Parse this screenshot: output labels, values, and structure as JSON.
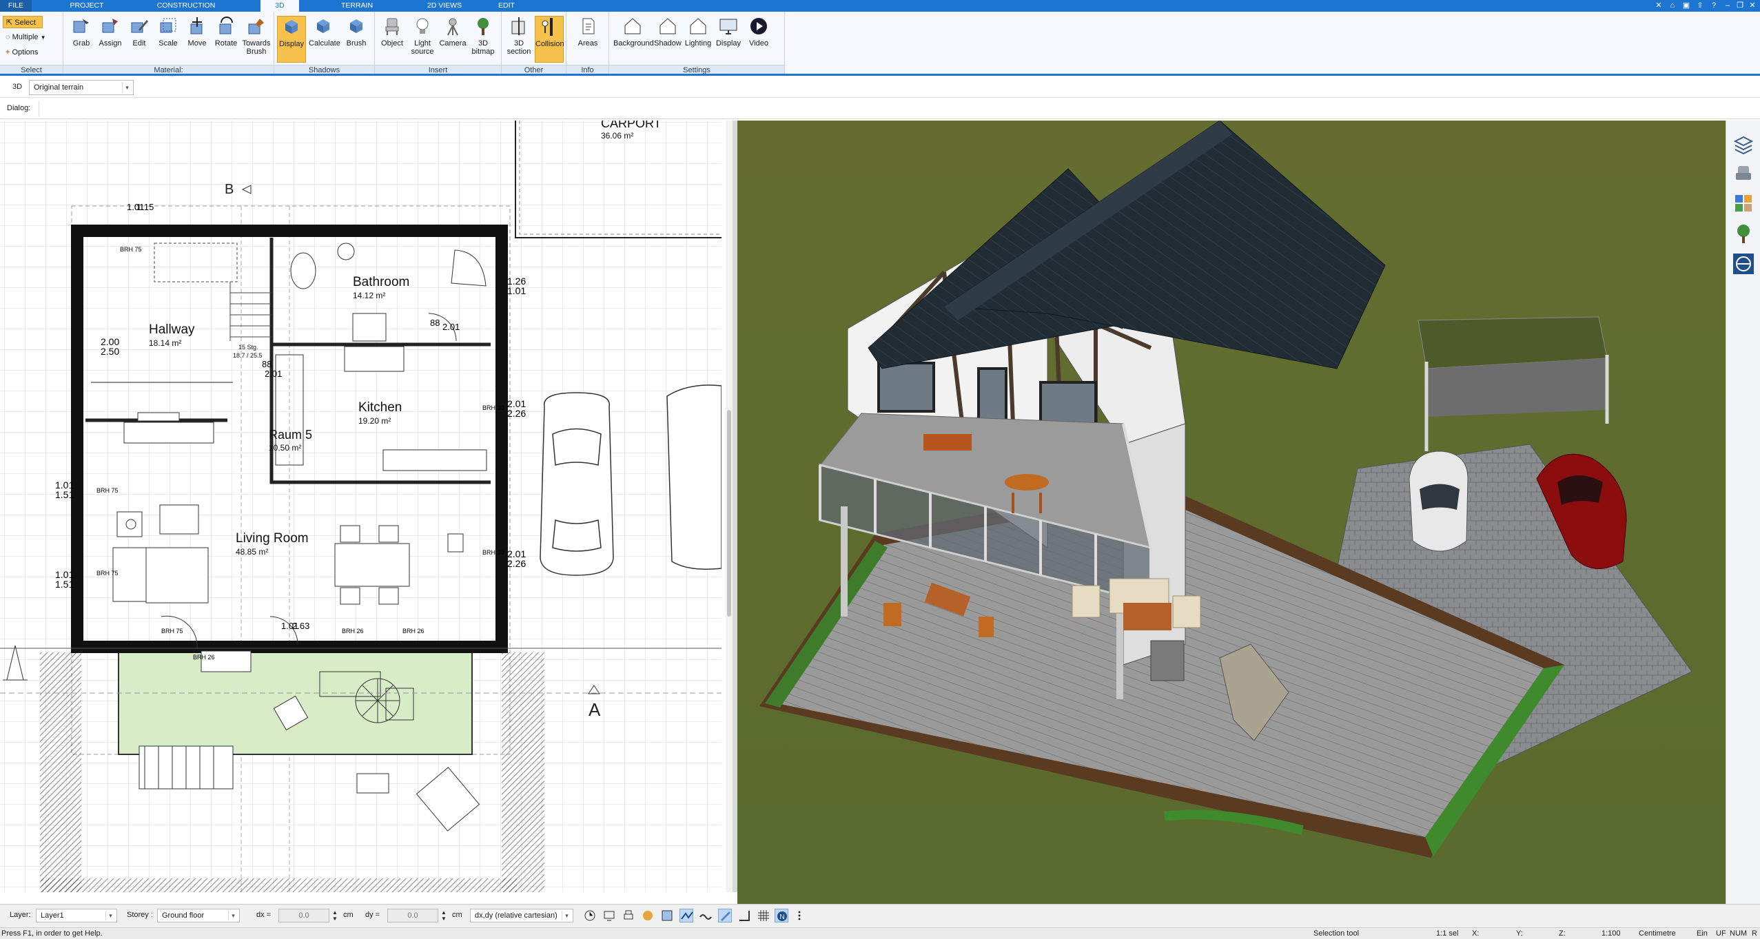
{
  "menu": {
    "tabs": [
      "FILE",
      "PROJECT",
      "CONSTRUCTION",
      "3D",
      "TERRAIN",
      "2D VIEWS",
      "EDIT"
    ],
    "active_tab": "3D"
  },
  "ribbon": {
    "select": {
      "select": "Select",
      "multiple": "Multiple",
      "options": "Options",
      "label": "Select"
    },
    "material": {
      "buttons": [
        "Grab",
        "Assign",
        "Edit",
        "Scale",
        "Move",
        "Rotate",
        "Towards Brush"
      ],
      "label": "Material:"
    },
    "shadows": {
      "buttons": [
        "Display",
        "Calculate",
        "Brush"
      ],
      "label": "Shadows"
    },
    "insert": {
      "buttons": [
        "Object",
        "Light source",
        "Camera",
        "3D bitmap"
      ],
      "label": "Insert"
    },
    "other": {
      "buttons": [
        "3D section",
        "Collision"
      ],
      "label": "Other"
    },
    "info": {
      "buttons": [
        "Areas"
      ],
      "label": "Info"
    },
    "settings": {
      "buttons": [
        "Background",
        "Shadow",
        "Lighting",
        "Display",
        "Video"
      ],
      "label": "Settings"
    }
  },
  "toolbar": {
    "mode_label": "3D",
    "terrain_value": "Original terrain",
    "dialog_label": "Dialog:"
  },
  "plan": {
    "rooms": [
      {
        "name": "Bathroom",
        "area": "14.12 m²"
      },
      {
        "name": "Hallway",
        "area": "18.14 m²"
      },
      {
        "name": "Kitchen",
        "area": "19.20 m²"
      },
      {
        "name": "Raum 5",
        "area": "10.50 m²"
      },
      {
        "name": "Living Room",
        "area": "48.85 m²"
      }
    ],
    "carport": {
      "name": "CARPORT",
      "area": "36.06 m²"
    },
    "section_markers": {
      "b": "B",
      "a": "A"
    },
    "dims": [
      "1.26",
      "1.01",
      "2.01",
      "2.26",
      "2.01",
      "2.26",
      "1.01",
      "1.51",
      "1.01",
      "1.51",
      "2.00",
      "2.50",
      "88",
      "2.01",
      "88",
      "2.01",
      "1.01",
      "2.63",
      "1.01",
      "1.15"
    ],
    "brh_labels": [
      "BRH 75",
      "BRH 30",
      "BRH 30",
      "BRH 26",
      "BRH 26",
      "BRH 75",
      "BRH 75",
      "BRH 75",
      "BRH 26"
    ],
    "stair_label": "15 Stg.",
    "stair_dims": "18.7 / 25.5"
  },
  "bottom": {
    "layer_label": "Layer:",
    "layer_value": "Layer1",
    "storey_label": "Storey :",
    "storey_value": "Ground floor",
    "dx_label": "dx =",
    "dx_value": "0.0",
    "dx_unit": "cm",
    "dy_label": "dy =",
    "dy_value": "0.0",
    "dy_unit": "cm",
    "coord_mode": "dx,dy (relative cartesian)"
  },
  "status": {
    "help": "Press F1, in order to get Help.",
    "tool": "Selection tool",
    "sel": "1:1 sel",
    "x": "X:",
    "y": "Y:",
    "z": "Z:",
    "scale": "1:100",
    "unit": "Centimetre",
    "ein": "Ein",
    "uf": "UF",
    "num": "NUM",
    "r": "R"
  },
  "colors": {
    "accent": "#1c75d0",
    "active_button": "#f7c24b",
    "grass": "#5f6a2f",
    "roof": "#1f2a33",
    "terrace_fill": "#d8ecc8"
  }
}
